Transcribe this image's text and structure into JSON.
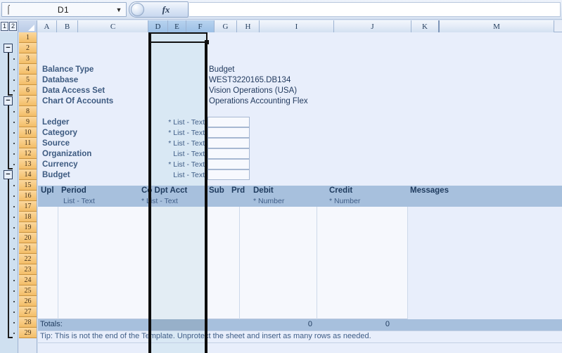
{
  "app": {
    "type": "spreadsheet",
    "name_box_value": "D1",
    "formula_value": "",
    "fx_label": "fx",
    "cursor_icon": "text-cursor-icon",
    "dropdown_icon": "chevron-down-icon"
  },
  "outline": {
    "level_buttons": [
      "1",
      "2"
    ],
    "collapse_glyph": "−"
  },
  "columns": [
    {
      "label": "A",
      "width": 28,
      "selected": false
    },
    {
      "label": "B",
      "width": 30,
      "selected": false
    },
    {
      "label": "C",
      "width": 100,
      "selected": false
    },
    {
      "label": "D",
      "width": 28,
      "selected": true
    },
    {
      "label": "E",
      "width": 26,
      "selected": true
    },
    {
      "label": "F",
      "width": 40,
      "selected": true
    },
    {
      "label": "G",
      "width": 32,
      "selected": false
    },
    {
      "label": "H",
      "width": 32,
      "selected": false
    },
    {
      "label": "I",
      "width": 106,
      "selected": false
    },
    {
      "label": "J",
      "width": 110,
      "selected": false
    },
    {
      "label": "K",
      "width": 40,
      "selected": false,
      "hidden_after": true
    },
    {
      "label": "M",
      "width": 163,
      "selected": false
    }
  ],
  "rows": [
    "1",
    "2",
    "3",
    "4",
    "5",
    "6",
    "7",
    "8",
    "9",
    "10",
    "11",
    "12",
    "13",
    "14",
    "15",
    "16",
    "17",
    "18",
    "19",
    "20",
    "21",
    "22",
    "23",
    "24",
    "25",
    "26",
    "27",
    "28",
    "29"
  ],
  "header_section": {
    "fields": [
      {
        "label": "Balance Type",
        "value": "Budget"
      },
      {
        "label": "Database",
        "value": "WEST3220165.DB134"
      },
      {
        "label": "Data Access Set",
        "value": "Vision Operations (USA)"
      },
      {
        "label": "Chart Of Accounts",
        "value": "Operations Accounting Flex"
      }
    ]
  },
  "parameters": {
    "fields": [
      {
        "label": "Ledger",
        "required": true,
        "type": "List - Text"
      },
      {
        "label": "Category",
        "required": true,
        "type": "List - Text"
      },
      {
        "label": "Source",
        "required": true,
        "type": "List - Text"
      },
      {
        "label": "Organization",
        "required": false,
        "type": "List - Text"
      },
      {
        "label": "Currency",
        "required": true,
        "type": "List - Text"
      },
      {
        "label": "Budget",
        "required": false,
        "type": "List - Text"
      }
    ],
    "required_marker": "*"
  },
  "table": {
    "headers": [
      {
        "label": "Upl",
        "subtype": ""
      },
      {
        "label": "Period",
        "subtype": "List - Text"
      },
      {
        "label": "Co Dpt Acct",
        "subtype": "* List - Text"
      },
      {
        "label": "Sub",
        "subtype": ""
      },
      {
        "label": "Prd",
        "subtype": ""
      },
      {
        "label": "Debit",
        "subtype": "* Number"
      },
      {
        "label": "Credit",
        "subtype": "* Number"
      },
      {
        "label": "Messages",
        "subtype": ""
      }
    ],
    "totals_label": "Totals:",
    "totals": {
      "debit": "0",
      "credit": "0"
    },
    "tip": "Tip: This is not the end of the Template.  Unprotect the sheet and insert as many rows as needed."
  },
  "colors": {
    "sheet_bg": "#e8eefb",
    "header_band": "#a7c0dd",
    "selected_col": "#d6e6f2",
    "row_header": "#f7c97f",
    "label_text": "#3d5a80"
  }
}
